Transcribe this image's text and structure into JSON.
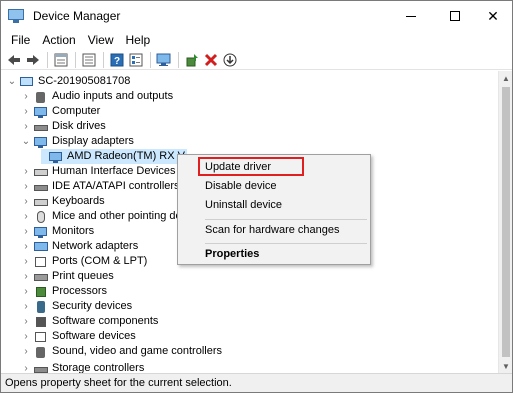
{
  "window": {
    "title": "Device Manager",
    "controls": {
      "minimize": "—",
      "maximize": "☐",
      "close": "✕"
    }
  },
  "menu": [
    "File",
    "Action",
    "View",
    "Help"
  ],
  "toolbar": {
    "icons": [
      "back-arrow-icon",
      "forward-arrow-icon",
      "properties-sheet-icon",
      "show-hidden-icon",
      "help-icon",
      "view-list-icon",
      "scan-monitor-icon",
      "update-driver-icon",
      "uninstall-icon",
      "download-icon"
    ],
    "colors": {
      "green": "#2e8b2e",
      "red": "#d11f1f",
      "blue": "#2a6fb5"
    }
  },
  "tree": {
    "root": "SC-201905081708",
    "items": [
      {
        "label": "Audio inputs and outputs",
        "icon": "speaker-icon",
        "expanded": false
      },
      {
        "label": "Computer",
        "icon": "computer-icon",
        "expanded": false
      },
      {
        "label": "Disk drives",
        "icon": "disk-drive-icon",
        "expanded": false
      },
      {
        "label": "Display adapters",
        "icon": "display-adapter-icon",
        "expanded": true
      },
      {
        "label": "AMD Radeon(TM) RX V",
        "icon": "display-adapter-icon",
        "child": true,
        "selected": true
      },
      {
        "label": "Human Interface Devices",
        "icon": "hid-icon",
        "expanded": false
      },
      {
        "label": "IDE ATA/ATAPI controllers",
        "icon": "ide-controller-icon",
        "expanded": false
      },
      {
        "label": "Keyboards",
        "icon": "keyboard-icon",
        "expanded": false
      },
      {
        "label": "Mice and other pointing de",
        "icon": "mouse-icon",
        "expanded": false
      },
      {
        "label": "Monitors",
        "icon": "monitor-icon",
        "expanded": false
      },
      {
        "label": "Network adapters",
        "icon": "network-adapter-icon",
        "expanded": false
      },
      {
        "label": "Ports (COM & LPT)",
        "icon": "port-icon",
        "expanded": false
      },
      {
        "label": "Print queues",
        "icon": "printer-icon",
        "expanded": false
      },
      {
        "label": "Processors",
        "icon": "processor-icon",
        "expanded": false
      },
      {
        "label": "Security devices",
        "icon": "security-device-icon",
        "expanded": false
      },
      {
        "label": "Software components",
        "icon": "software-component-icon",
        "expanded": false
      },
      {
        "label": "Software devices",
        "icon": "software-device-icon",
        "expanded": false
      },
      {
        "label": "Sound, video and game controllers",
        "icon": "sound-icon",
        "expanded": false
      },
      {
        "label": "Storage controllers",
        "icon": "storage-controller-icon",
        "expanded": false
      }
    ]
  },
  "context_menu": {
    "items": [
      {
        "label": "Update driver",
        "bold": false,
        "highlighted": true
      },
      {
        "label": "Disable device",
        "bold": false
      },
      {
        "label": "Uninstall device",
        "bold": false
      },
      {
        "label": "Scan for hardware changes",
        "bold": false
      },
      {
        "label": "Properties",
        "bold": true
      }
    ],
    "highlight_color": "#e02020"
  },
  "status": "Opens property sheet for the current selection."
}
